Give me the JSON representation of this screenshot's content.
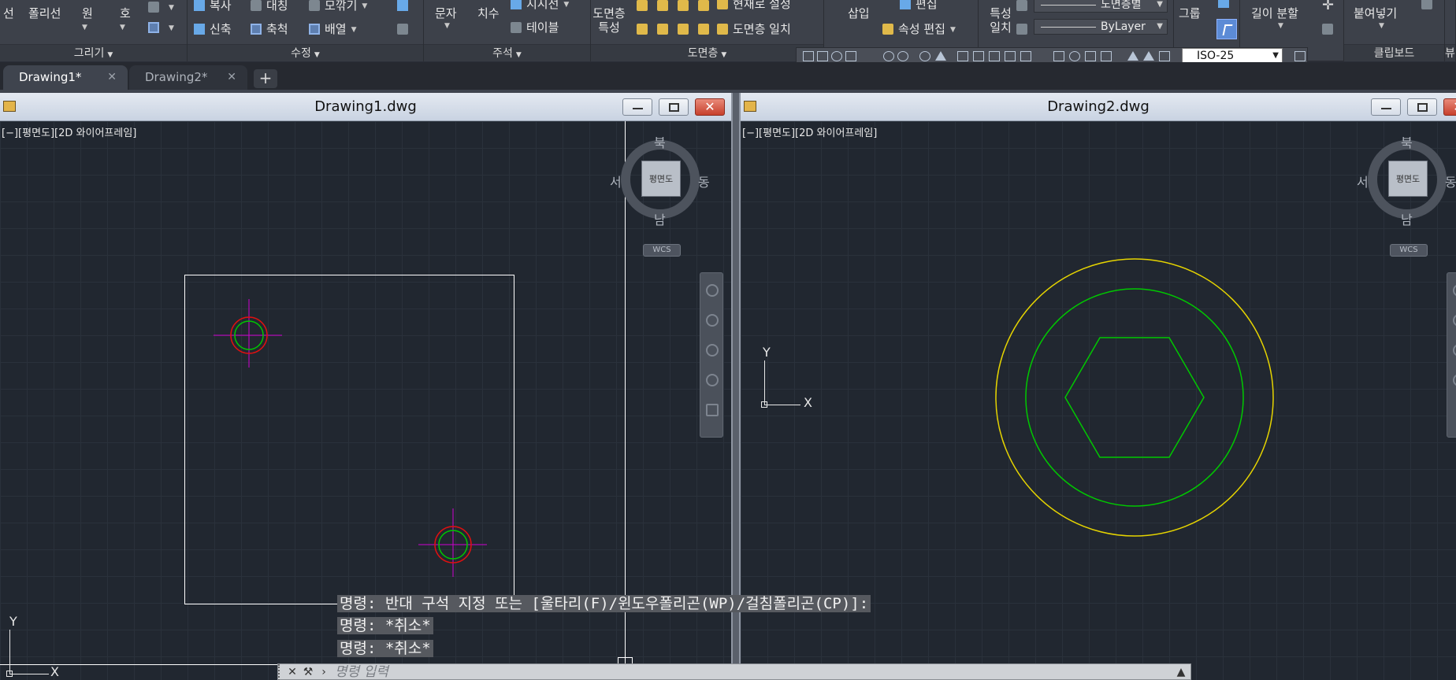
{
  "ribbon": {
    "draw_panel": {
      "title": "그리기",
      "items": [
        "선",
        "폴리선",
        "원",
        "호"
      ]
    },
    "modify_panel": {
      "title": "수정",
      "items": [
        "복사",
        "대칭",
        "모깎기",
        "신축",
        "축척",
        "배열"
      ]
    },
    "annotation_panel": {
      "title": "주석",
      "items": [
        "문자",
        "치수",
        "지시선",
        "테이블"
      ]
    },
    "layers_panel": {
      "title": "도면층",
      "layer_properties": "도면층 특성",
      "set_current": "현재로 설정",
      "match_layer": "도면층 일치"
    },
    "block_panel": {
      "insert": "삽입",
      "edit": "편집",
      "edit_attributes": "속성 편집"
    },
    "properties_panel": {
      "match_properties": "특성 일치",
      "layer_combo": "도면층별",
      "linetype_combo": "ByLayer"
    },
    "groups_panel": {
      "group": "그룹"
    },
    "utilities_panel": {
      "measure": "길이 분할"
    },
    "clipboard_panel": {
      "title": "클립보드",
      "paste": "붙여넣기"
    },
    "view_panel_short": "뷰",
    "dim_style": "ISO-25"
  },
  "tabs": [
    {
      "label": "Drawing1*",
      "active": true
    },
    {
      "label": "Drawing2*",
      "active": false
    }
  ],
  "window1": {
    "title": "Drawing1.dwg",
    "viewport_label": "[−][평면도][2D 와이어프레임]",
    "viewcube": {
      "top": "평면도",
      "north": "북",
      "south": "남",
      "east": "동",
      "west": "서",
      "wcs": "WCS"
    },
    "ucs": {
      "x": "X",
      "y": "Y"
    }
  },
  "window2": {
    "title": "Drawing2.dwg",
    "viewport_label": "[−][평면도][2D 와이어프레임]",
    "viewcube": {
      "top": "평면도",
      "north": "북",
      "south": "남",
      "east": "동",
      "west": "서",
      "wcs": "WCS"
    },
    "ucs": {
      "x": "X",
      "y": "Y"
    }
  },
  "command_history": [
    "명령: 반대 구석 지정 또는 [울타리(F)/윈도우폴리곤(WP)/걸침폴리곤(CP)]:",
    "명령: *취소*",
    "명령: *취소*"
  ],
  "command_input": {
    "placeholder": "명령 입력"
  },
  "colors": {
    "background": "#212730",
    "geometry_white": "#ffffff",
    "geometry_green": "#00c800",
    "geometry_red": "#e01010",
    "geometry_magenta": "#d000d0",
    "geometry_yellow": "#e6d400"
  }
}
